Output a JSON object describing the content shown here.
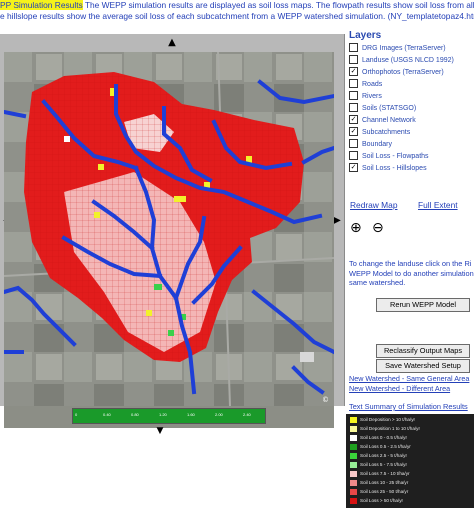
{
  "intro": {
    "title": "PP Simulation Results",
    "line1_rest": " The WEPP simulation results are displayed as soil loss maps. The flowpath results show soil loss from all flowpaths in",
    "line2": "e hillslope results show the average soil loss of each subcatchment from a WEPP watershed simulation. (NY_templatetopaz4.html)"
  },
  "map": {
    "pan_up": "▲",
    "pan_left": "◀",
    "pan_right": "▶",
    "pan_down": "▼",
    "credit": "©",
    "scale_ticks": [
      "0",
      "0.40",
      "0.80",
      "1.20",
      "1.60",
      "2.00",
      "2.40"
    ],
    "colors": {
      "aerial": "#8c8e86",
      "watershed": "#e21c1c",
      "low_loss": "#f4b6b6",
      "channel": "#1f3fd6",
      "deposition": "#f2f22a",
      "green": "#39d04a"
    }
  },
  "layers": {
    "title": "Layers",
    "items": [
      {
        "label": "DRG Images (TerraServer)",
        "checked": false
      },
      {
        "label": "Landuse (USGS NLCD 1992)",
        "checked": false
      },
      {
        "label": "Orthophotos (TerraServer)",
        "checked": true
      },
      {
        "label": "Roads",
        "checked": false
      },
      {
        "label": "Rivers",
        "checked": false
      },
      {
        "label": "Soils (STATSGO)",
        "checked": false
      },
      {
        "label": "Channel Network",
        "checked": true
      },
      {
        "label": "Subcatchments",
        "checked": true
      },
      {
        "label": "Boundary",
        "checked": false
      },
      {
        "label": "Soil Loss - Flowpaths",
        "checked": false
      },
      {
        "label": "Soil Loss - Hillslopes",
        "checked": true
      }
    ],
    "redraw": "Redraw Map",
    "full_extent": "Full Extent",
    "zoom_in": "⊕",
    "zoom_out": "⊖"
  },
  "note": {
    "line1": "To change the landuse click on the Ri",
    "line2": "WEPP Model to do another simulation",
    "line3": "same watershed."
  },
  "buttons": {
    "rerun": "Rerun WEPP Model",
    "reclassify": "Reclassify Output Maps",
    "save": "Save Watershed Setup"
  },
  "nav": {
    "same_area": "New Watershed - Same General Area",
    "different_area": "New Watershed - Different Area",
    "summary": "Text Summary of Simulation Results"
  },
  "legend": [
    {
      "label": "Soil Deposition > 10 t/ha/yr",
      "color": "#f5f51e"
    },
    {
      "label": "Soil Deposition 1 to 10 t/ha/yr",
      "color": "#f9f99a"
    },
    {
      "label": "Soil Loss 0 - 0.5 t/ha/yr",
      "color": "#ffffff"
    },
    {
      "label": "Soil Loss 0.5 - 2.5 t/ha/yr",
      "color": "#1fa11f"
    },
    {
      "label": "Soil Loss 2.5 - 5 t/ha/yr",
      "color": "#3ad33a"
    },
    {
      "label": "Soil Loss 5 - 7.5 t/ha/yr",
      "color": "#97ee97"
    },
    {
      "label": "Soil Loss 7.5 - 10 t/ha/yr",
      "color": "#f7c8c8"
    },
    {
      "label": "Soil Loss 10 - 25 t/ha/yr",
      "color": "#f08a8a"
    },
    {
      "label": "Soil Loss 25 - 50 t/ha/yr",
      "color": "#e84848"
    },
    {
      "label": "Soil Loss > 50 t/ha/yr",
      "color": "#d61212"
    }
  ]
}
